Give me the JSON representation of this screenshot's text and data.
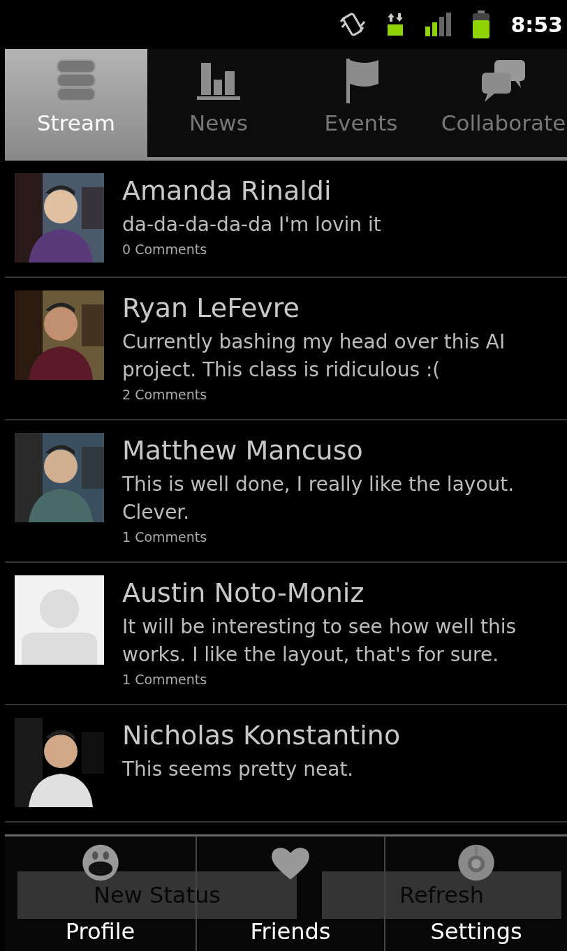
{
  "status_bar": {
    "time": "8:53"
  },
  "tabs": [
    {
      "label": "Stream",
      "selected": true
    },
    {
      "label": "News",
      "selected": false
    },
    {
      "label": "Events",
      "selected": false
    },
    {
      "label": "Collaborate",
      "selected": false
    }
  ],
  "stream": [
    {
      "name": "Amanda Rinaldi",
      "message": "da-da-da-da-da I'm lovin it",
      "comments": "0 Comments"
    },
    {
      "name": "Ryan LeFevre",
      "message": "Currently bashing my head over this AI project. This class is ridiculous :(",
      "comments": "2 Comments"
    },
    {
      "name": "Matthew Mancuso",
      "message": "This is well done, I really like the layout. Clever.",
      "comments": "1 Comments"
    },
    {
      "name": "Austin Noto-Moniz",
      "message": "It will be interesting to see how well this works. I like the layout, that's for sure.",
      "comments": "1 Comments",
      "avatar": {
        "kind": "placeholder"
      }
    },
    {
      "name": "Nicholas Konstantino",
      "message": "This seems pretty neat."
    }
  ],
  "buttons": [
    {
      "label": "New Status"
    },
    {
      "label": "Refresh"
    }
  ],
  "menu": [
    {
      "label": "Profile"
    },
    {
      "label": "Friends"
    },
    {
      "label": "Settings"
    }
  ]
}
